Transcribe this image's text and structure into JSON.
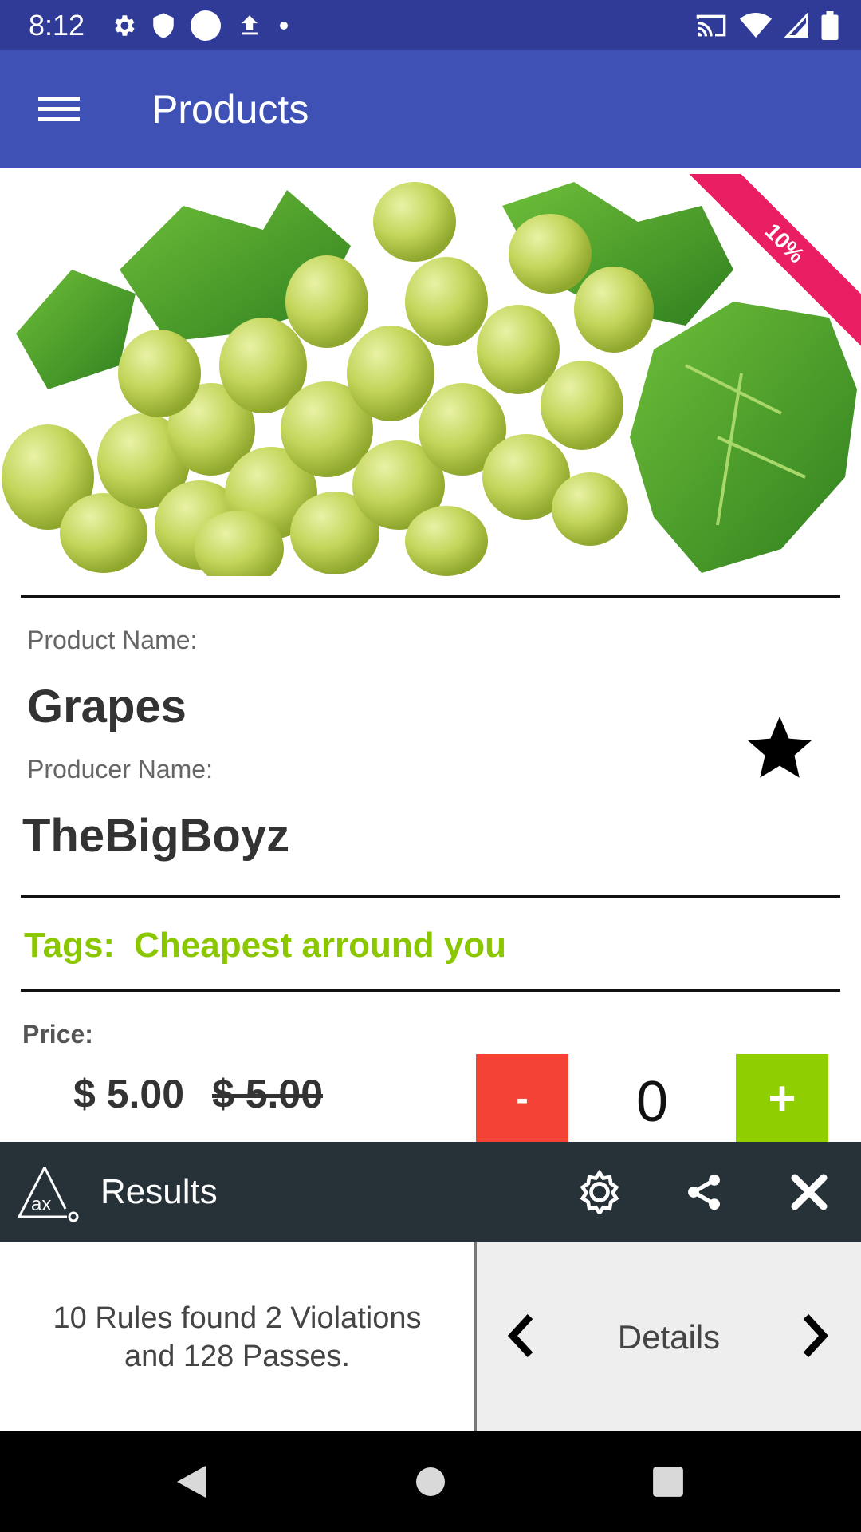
{
  "status_bar": {
    "time": "8:12",
    "left_icons": [
      "gear-icon",
      "shield-icon",
      "circle-icon",
      "upload-icon",
      "dot-icon"
    ],
    "right_icons": [
      "cast-icon",
      "wifi-icon",
      "signal-icon",
      "battery-icon"
    ]
  },
  "app_bar": {
    "title": "Products",
    "menu_icon": "hamburger-menu-icon"
  },
  "product": {
    "image_subject": "green grapes",
    "discount_badge": "10%",
    "product_name_label": "Product Name:",
    "product_name": "Grapes",
    "producer_name_label": "Producer Name:",
    "producer_name": "TheBigBoyz",
    "favorite_icon": "star-icon",
    "tags_label": "Tags:",
    "tags_value": "Cheapest arround you",
    "price_label": "Price:",
    "price_current": "$ 5.00",
    "price_original": "$ 5.00",
    "quantity_minus_label": "-",
    "quantity": "0",
    "quantity_plus_label": "+"
  },
  "accessibility_panel": {
    "logo_text": "ax",
    "title": "Results",
    "summary": "10 Rules found 2 Violations and 128 Passes.",
    "details_label": "Details",
    "actions": [
      "settings-icon",
      "share-icon",
      "close-icon"
    ]
  },
  "nav_bar": {
    "buttons": [
      "back-icon",
      "home-icon",
      "recents-icon"
    ]
  },
  "colors": {
    "status_bar": "#2f3b97",
    "app_bar": "#3f51b5",
    "discount": "#e91e63",
    "tags": "#8bc700",
    "minus_button": "#f44336",
    "plus_button": "#8fce00",
    "ax_bar": "#263238"
  }
}
